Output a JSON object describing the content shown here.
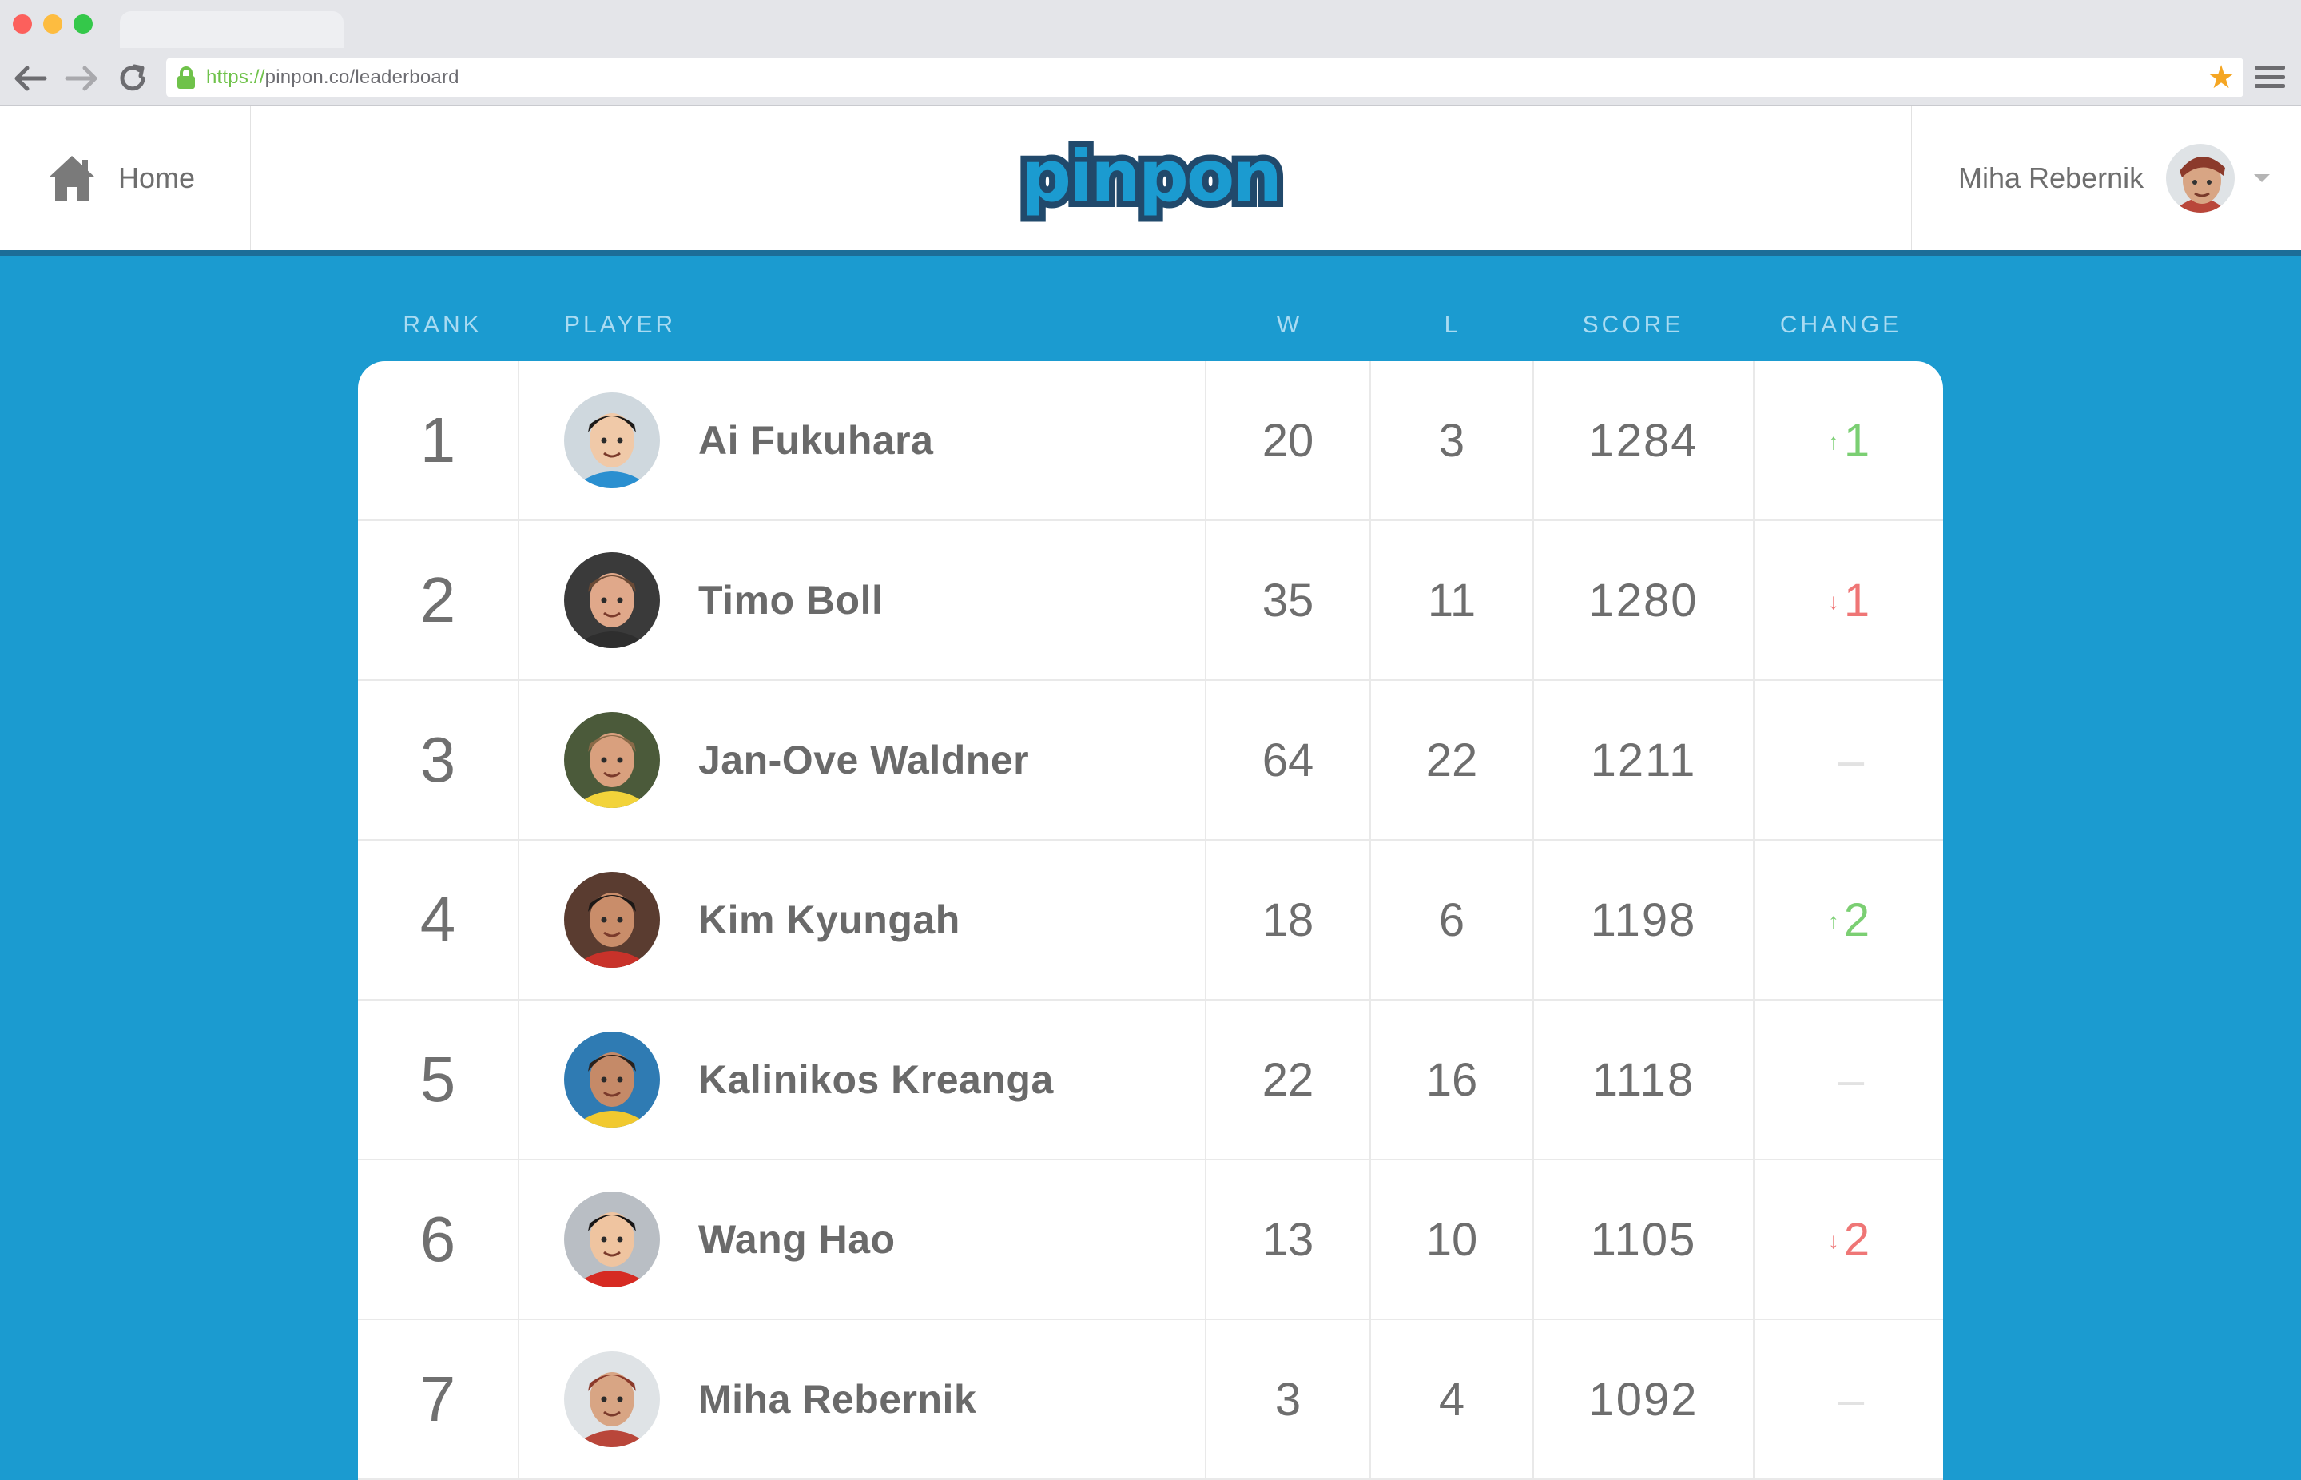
{
  "browser": {
    "url_scheme": "https://",
    "url_rest": "pinpon.co/leaderboard",
    "back_icon": "arrow-left-icon",
    "forward_icon": "arrow-right-icon",
    "reload_icon": "reload-icon",
    "bookmark_icon": "star-icon",
    "menu_icon": "hamburger-icon"
  },
  "header": {
    "home_label": "Home",
    "logo_text": "pinpon",
    "user_name": "Miha Rebernik",
    "colors": {
      "brand": "#1b9bd0",
      "logo_outline": "#21496b",
      "header_rule": "#1c6d98"
    }
  },
  "table": {
    "columns": {
      "rank": "RANK",
      "player": "PLAYER",
      "wins": "W",
      "losses": "L",
      "score": "SCORE",
      "change": "CHANGE"
    },
    "rows": [
      {
        "rank": "1",
        "name": "Ai Fukuhara",
        "wins": "20",
        "losses": "3",
        "score": "1284",
        "change": "1",
        "direction": "up",
        "arrow": "↑"
      },
      {
        "rank": "2",
        "name": "Timo Boll",
        "wins": "35",
        "losses": "11",
        "score": "1280",
        "change": "1",
        "direction": "down",
        "arrow": "↓"
      },
      {
        "rank": "3",
        "name": "Jan-Ove Waldner",
        "wins": "64",
        "losses": "22",
        "score": "1211",
        "change": "–",
        "direction": "none",
        "arrow": ""
      },
      {
        "rank": "4",
        "name": "Kim Kyungah",
        "wins": "18",
        "losses": "6",
        "score": "1198",
        "change": "2",
        "direction": "up",
        "arrow": "↑"
      },
      {
        "rank": "5",
        "name": "Kalinikos Kreanga",
        "wins": "22",
        "losses": "16",
        "score": "1118",
        "change": "–",
        "direction": "none",
        "arrow": ""
      },
      {
        "rank": "6",
        "name": "Wang Hao",
        "wins": "13",
        "losses": "10",
        "score": "1105",
        "change": "2",
        "direction": "down",
        "arrow": "↓"
      },
      {
        "rank": "7",
        "name": "Miha Rebernik",
        "wins": "3",
        "losses": "4",
        "score": "1092",
        "change": "–",
        "direction": "none",
        "arrow": ""
      }
    ],
    "colors": {
      "up": "#7bcf73",
      "down": "#ef7676",
      "none": "#e2e2e2"
    }
  }
}
